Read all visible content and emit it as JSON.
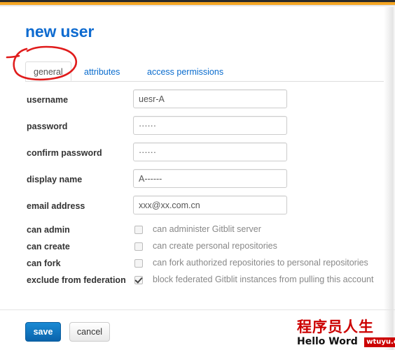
{
  "chrome": {
    "top_bar_color": "#2b2b2b",
    "accent_bar_color": "#f5a623"
  },
  "header": {
    "title": "new user",
    "title_color": "#0e6bd0"
  },
  "tabs": [
    {
      "label": "general",
      "active": true
    },
    {
      "label": "attributes",
      "active": false
    },
    {
      "label": "access permissions",
      "active": false
    }
  ],
  "annotation": {
    "type": "hand-drawn-ellipse",
    "color": "#e01b1b",
    "targets": "general"
  },
  "form": {
    "fields": [
      {
        "label": "username",
        "value": "uesr-A",
        "type": "text"
      },
      {
        "label": "password",
        "value": "······",
        "type": "password"
      },
      {
        "label": "confirm password",
        "value": "······",
        "type": "password"
      },
      {
        "label": "display name",
        "value": "A------",
        "type": "text"
      },
      {
        "label": "email address",
        "value": "xxx@xx.com.cn",
        "type": "text"
      }
    ],
    "checkboxes": [
      {
        "label": "can admin",
        "hint": "can administer Gitblit server",
        "checked": false
      },
      {
        "label": "can create",
        "hint": "can create personal repositories",
        "checked": false
      },
      {
        "label": "can fork",
        "hint": "can fork authorized repositories to personal repositories",
        "checked": false
      },
      {
        "label": "exclude from federation",
        "hint": "block federated Gitblit instances from pulling this account",
        "checked": true
      }
    ]
  },
  "footer": {
    "save_label": "save",
    "cancel_label": "cancel",
    "save_color": "#0f7ec8"
  },
  "watermark": {
    "chinese": "程序员人生",
    "english": "Hello Word",
    "url": "wtuyu.com",
    "color": "#cc0000"
  }
}
